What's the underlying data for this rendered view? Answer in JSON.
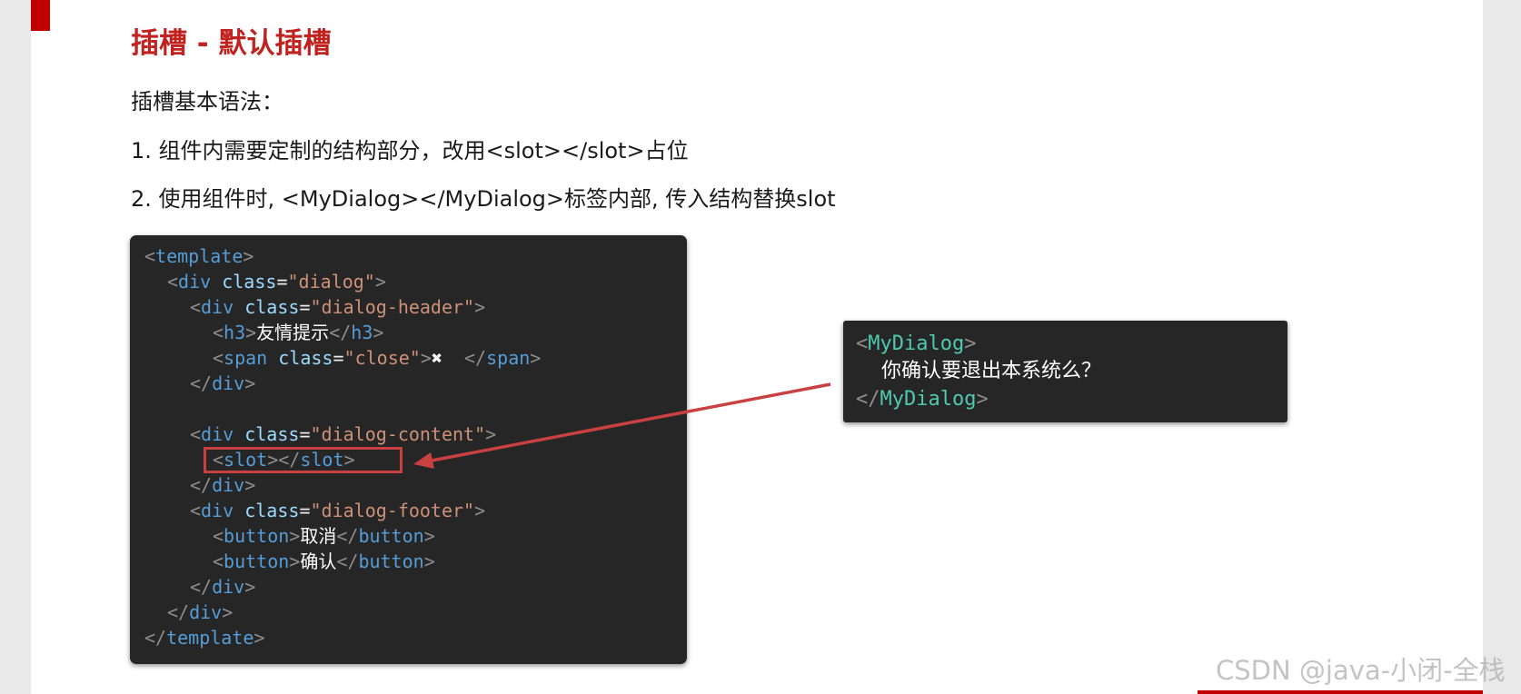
{
  "slide": {
    "title": "插槽 - 默认插槽",
    "intro": "插槽基本语法：",
    "steps": [
      "1. 组件内需要定制的结构部分，改用<slot></slot>占位",
      "2. 使用组件时, <MyDialog></MyDialog>标签内部, 传入结构替换slot"
    ],
    "watermark": "CSDN @java-小闭-全栈"
  },
  "component_code": {
    "open_template": "template",
    "div": "div",
    "cls": "class",
    "eq": "=",
    "dialog_class": "\"dialog\"",
    "header_class": "\"dialog-header\"",
    "h3": "h3",
    "h3_text": "友情提示",
    "span": "span",
    "close_class": "\"close\"",
    "close_symbol": "✖",
    "content_class": "\"dialog-content\"",
    "slot": "slot",
    "footer_class": "\"dialog-footer\"",
    "button": "button",
    "cancel_text": "取消",
    "confirm_text": "确认"
  },
  "usage_code": {
    "component": "MyDialog",
    "content": "你确认要退出本系统么？"
  },
  "colors": {
    "accent": "#c00000",
    "title": "#c0221f",
    "code_bg": "#262626",
    "highlight": "#c94040"
  }
}
